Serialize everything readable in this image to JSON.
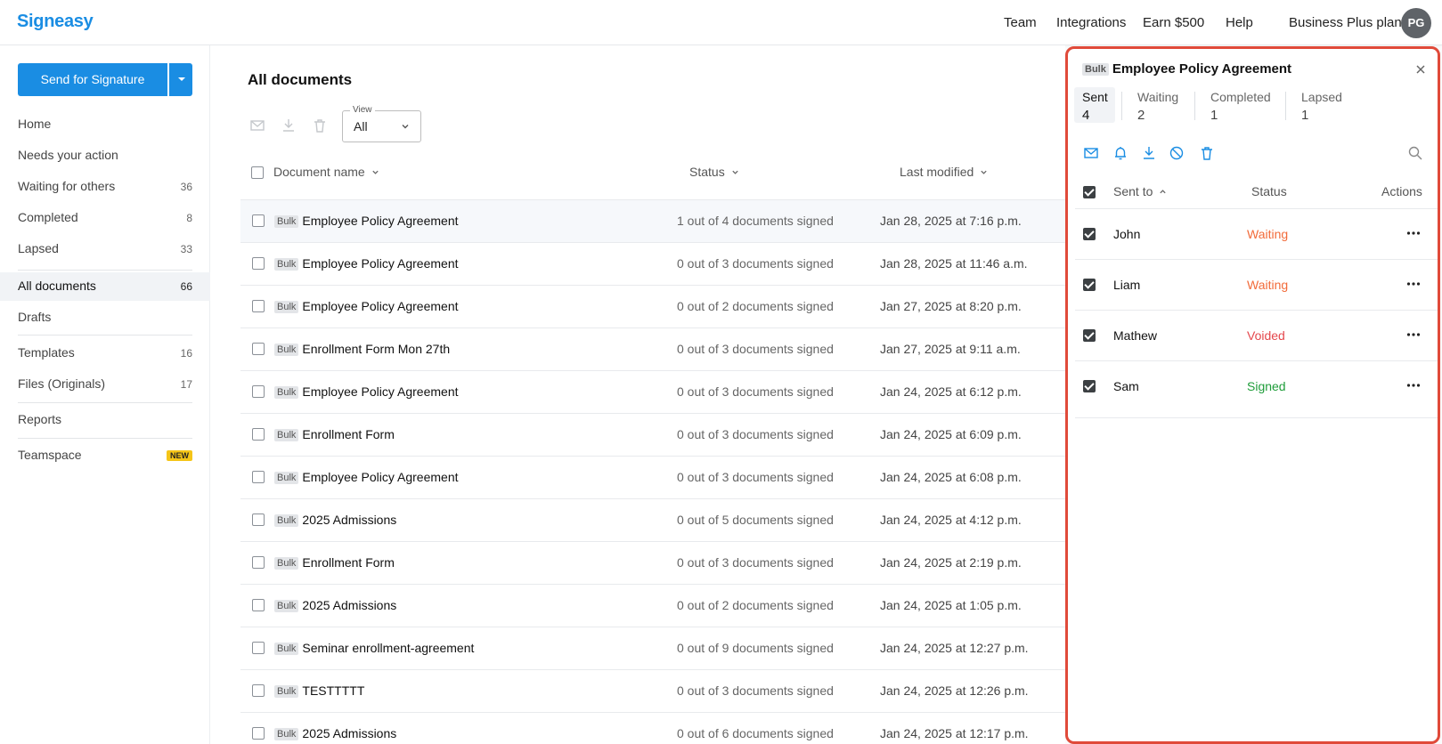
{
  "app": {
    "logo": "Signeasy"
  },
  "topnav": {
    "team": "Team",
    "integrations": "Integrations",
    "earn": "Earn $500",
    "help": "Help",
    "plan": "Business Plus plan",
    "avatar": "PG"
  },
  "sidebar": {
    "send_label": "Send for Signature",
    "items": [
      {
        "label": "Home",
        "count": ""
      },
      {
        "label": "Needs your action",
        "count": ""
      },
      {
        "label": "Waiting for others",
        "count": "36"
      },
      {
        "label": "Completed",
        "count": "8"
      },
      {
        "label": "Lapsed",
        "count": "33"
      },
      {
        "label": "All documents",
        "count": "66"
      },
      {
        "label": "Drafts",
        "count": ""
      },
      {
        "label": "Templates",
        "count": "16"
      },
      {
        "label": "Files (Originals)",
        "count": "17"
      },
      {
        "label": "Reports",
        "count": ""
      },
      {
        "label": "Teamspace",
        "badge": "NEW"
      }
    ]
  },
  "main": {
    "title": "All documents",
    "view_label": "View",
    "view_value": "All",
    "columns": {
      "name": "Document name",
      "status": "Status",
      "modified": "Last modified"
    },
    "bulk_tag": "Bulk",
    "rows": [
      {
        "name": "Employee Policy Agreement",
        "status": "1 out of 4 documents signed",
        "modified": "Jan 28, 2025 at 7:16 p.m."
      },
      {
        "name": "Employee Policy Agreement",
        "status": "0 out of 3 documents signed",
        "modified": "Jan 28, 2025 at 11:46 a.m."
      },
      {
        "name": "Employee Policy Agreement",
        "status": "0 out of 2 documents signed",
        "modified": "Jan 27, 2025 at 8:20 p.m."
      },
      {
        "name": "Enrollment Form Mon 27th",
        "status": "0 out of 3 documents signed",
        "modified": "Jan 27, 2025 at 9:11 a.m."
      },
      {
        "name": "Employee Policy Agreement",
        "status": "0 out of 3 documents signed",
        "modified": "Jan 24, 2025 at 6:12 p.m."
      },
      {
        "name": "Enrollment Form",
        "status": "0 out of 3 documents signed",
        "modified": "Jan 24, 2025 at 6:09 p.m."
      },
      {
        "name": "Employee Policy Agreement",
        "status": "0 out of 3 documents signed",
        "modified": "Jan 24, 2025 at 6:08 p.m."
      },
      {
        "name": "2025 Admissions",
        "status": "0 out of 5 documents signed",
        "modified": "Jan 24, 2025 at 4:12 p.m."
      },
      {
        "name": "Enrollment Form",
        "status": "0 out of 3 documents signed",
        "modified": "Jan 24, 2025 at 2:19 p.m."
      },
      {
        "name": "2025 Admissions",
        "status": "0 out of 2 documents signed",
        "modified": "Jan 24, 2025 at 1:05 p.m."
      },
      {
        "name": "Seminar enrollment-agreement",
        "status": "0 out of 9 documents signed",
        "modified": "Jan 24, 2025 at 12:27 p.m."
      },
      {
        "name": "TESTTTTT",
        "status": "0 out of 3 documents signed",
        "modified": "Jan 24, 2025 at 12:26 p.m."
      },
      {
        "name": "2025 Admissions",
        "status": "0 out of 6 documents signed",
        "modified": "Jan 24, 2025 at 12:17 p.m."
      }
    ]
  },
  "panel": {
    "bulk_tag": "Bulk",
    "title": "Employee Policy Agreement",
    "tabs": [
      {
        "label": "Sent",
        "value": "4"
      },
      {
        "label": "Waiting",
        "value": "2"
      },
      {
        "label": "Completed",
        "value": "1"
      },
      {
        "label": "Lapsed",
        "value": "1"
      }
    ],
    "columns": {
      "sent_to": "Sent to",
      "status": "Status",
      "actions": "Actions"
    },
    "recipients": [
      {
        "name": "John",
        "status": "Waiting",
        "color": "#f26b3a"
      },
      {
        "name": "Liam",
        "status": "Waiting",
        "color": "#f26b3a"
      },
      {
        "name": "Mathew",
        "status": "Voided",
        "color": "#e5484d"
      },
      {
        "name": "Sam",
        "status": "Signed",
        "color": "#1f9d3a"
      }
    ]
  },
  "colors": {
    "brand": "#1a8de3",
    "highlight_border": "#e04a3a"
  }
}
